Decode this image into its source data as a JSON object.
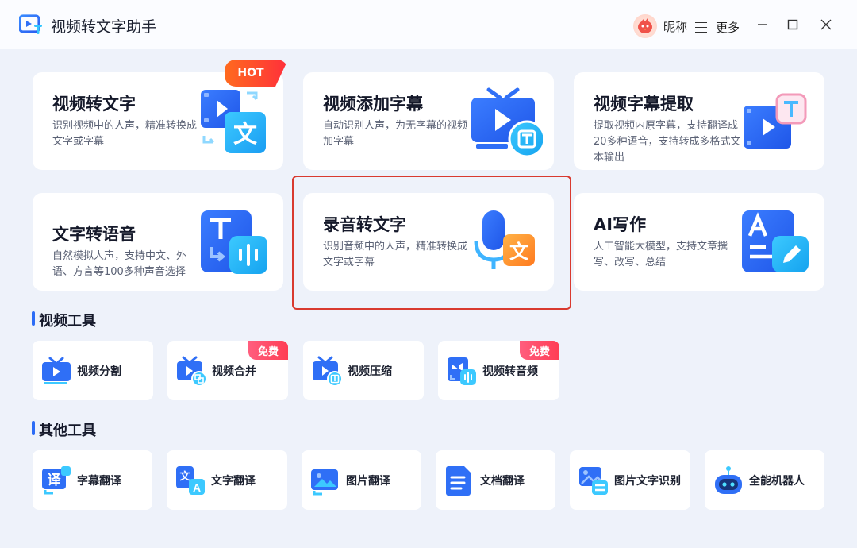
{
  "app": {
    "title": "视频转文字助手"
  },
  "header": {
    "nickname": "昵称",
    "more_label": "更多"
  },
  "features": [
    {
      "title": "视频转文字",
      "desc": "识别视频中的人声，精准转换成文字或字幕",
      "badge": "HOT",
      "icon": "video-to-text-icon"
    },
    {
      "title": "视频添加字幕",
      "desc": "自动识别人声，为无字幕的视频加字幕",
      "icon": "tv-subtitle-icon"
    },
    {
      "title": "视频字幕提取",
      "desc": "提取视频内原字幕，支持翻译成20多种语音，支持转成多格式文本输出",
      "icon": "subtitle-extract-icon"
    },
    {
      "title": "文字转语音",
      "desc": "自然模拟人声，支持中文、外语、方言等100多种声音选择",
      "icon": "text-to-speech-icon"
    },
    {
      "title": "录音转文字",
      "desc": "识别音频中的人声，精准转换成文字或字幕",
      "icon": "microphone-text-icon"
    },
    {
      "title": "AI写作",
      "desc": "人工智能大模型，支持文章撰写、改写、总结",
      "icon": "ai-writing-icon"
    }
  ],
  "video_tools": {
    "title": "视频工具",
    "items": [
      {
        "label": "视频分割",
        "icon": "video-split-icon"
      },
      {
        "label": "视频合并",
        "badge": "免费",
        "icon": "video-merge-icon"
      },
      {
        "label": "视频压缩",
        "icon": "video-compress-icon"
      },
      {
        "label": "视频转音频",
        "badge": "免费",
        "icon": "video-to-audio-icon"
      }
    ]
  },
  "other_tools": {
    "title": "其他工具",
    "items": [
      {
        "label": "字幕翻译",
        "icon": "subtitle-translate-icon"
      },
      {
        "label": "文字翻译",
        "icon": "text-translate-icon"
      },
      {
        "label": "图片翻译",
        "icon": "image-translate-icon"
      },
      {
        "label": "文档翻译",
        "icon": "document-translate-icon"
      },
      {
        "label": "图片文字识别",
        "icon": "ocr-icon"
      },
      {
        "label": "全能机器人",
        "icon": "robot-icon"
      }
    ]
  },
  "colors": {
    "accent": "#2c6cf6",
    "hot": "#ff4a2a",
    "free": "#ff4d66",
    "highlight": "#d93a2f"
  }
}
